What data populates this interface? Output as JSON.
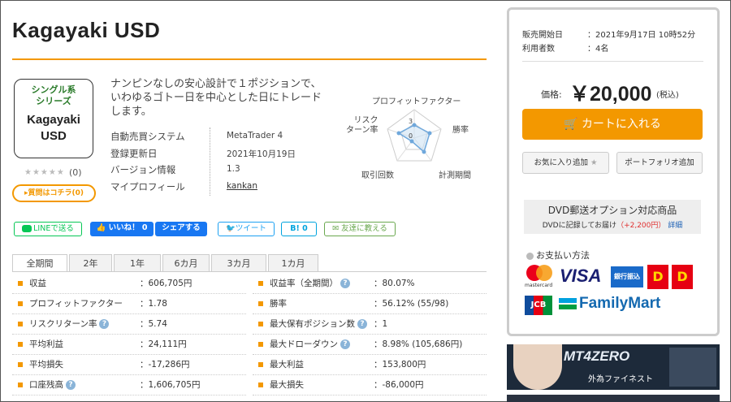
{
  "title": "Kagayaki USD",
  "product_icon": {
    "line1": "シングル系\nシリーズ",
    "line2": "Kagayaki\nUSD"
  },
  "rating": {
    "stars": "★★★★★",
    "count": "(0)"
  },
  "question_button": "▸質問はコチラ(0)",
  "description": "ナンピンなしの安心設計で１ポジションで、いわゆるゴトー日を中心とした日にトレードします。",
  "info": [
    {
      "label": "自動売買システム",
      "value": "MetaTrader 4"
    },
    {
      "label": "登録更新日",
      "value": "2021年10月19日"
    },
    {
      "label": "バージョン情報",
      "value": "1.3"
    },
    {
      "label": "マイプロフィール",
      "value": "kankan"
    }
  ],
  "radar": {
    "labels": {
      "pf": "プロフィットファクター",
      "win": "勝率",
      "period": "計測期間",
      "trades": "取引回数",
      "risk": "リスク\nターン率"
    },
    "scale_max": "3",
    "scale_min": "0"
  },
  "social": {
    "line": "LINEで送る",
    "fb_like": "いいね！ 0",
    "fb_share": "シェアする",
    "tweet": "ツイート",
    "hatena": "B! 0",
    "friend": "友達に教える"
  },
  "tabs": [
    "全期間",
    "2年",
    "1年",
    "6カ月",
    "3カ月",
    "1カ月"
  ],
  "stats_left": [
    {
      "label": "収益",
      "value": "：606,705円",
      "help": false
    },
    {
      "label": "プロフィットファクター",
      "value": "：1.78",
      "help": false
    },
    {
      "label": "リスクリターン率",
      "value": "：5.74",
      "help": true
    },
    {
      "label": "平均利益",
      "value": "：24,111円",
      "help": false
    },
    {
      "label": "平均損失",
      "value": "：-17,286円",
      "help": false
    },
    {
      "label": "口座残高",
      "value": "：1,606,705円",
      "help": true
    }
  ],
  "stats_right": [
    {
      "label": "収益率（全期間）",
      "value": "：80.07%",
      "help": true
    },
    {
      "label": "勝率",
      "value": "：56.12% (55/98)",
      "help": false
    },
    {
      "label": "最大保有ポジション数",
      "value": "：1",
      "help": true
    },
    {
      "label": "最大ドローダウン",
      "value": "：8.98% (105,686円)",
      "help": true
    },
    {
      "label": "最大利益",
      "value": "：153,800円",
      "help": false
    },
    {
      "label": "最大損失",
      "value": "：-86,000円",
      "help": false
    }
  ],
  "help_glyph": "?",
  "panel": {
    "sale_start_label": "販売開始日",
    "sale_start_value": "：2021年9月17日 10時52分",
    "users_label": "利用者数",
    "users_value": "：4名",
    "price_label": "価格:",
    "price_value": "￥20,000",
    "price_tax": "(税込)",
    "cart_button": "カートに入れる",
    "favorite_button": "お気に入り追加",
    "portfolio_button": "ポートフォリオ追加",
    "dvd_title": "DVD郵送オプション対応商品",
    "dvd_sub_1": "DVDに記録してお届け",
    "dvd_sub_price": "（+2,200円）",
    "dvd_link": "詳細",
    "payment_title": "お支払い方法",
    "payments": [
      "mastercard",
      "VISA",
      "銀行振込",
      "D",
      "D",
      "JCB",
      "FamilyMart"
    ]
  },
  "banner": {
    "brand": "MT4ZERO",
    "sub": "外為ファイネスト"
  },
  "colors": {
    "accent": "#f39800",
    "fb": "#1877f2",
    "line": "#06c755",
    "twitter": "#1da1f2"
  }
}
